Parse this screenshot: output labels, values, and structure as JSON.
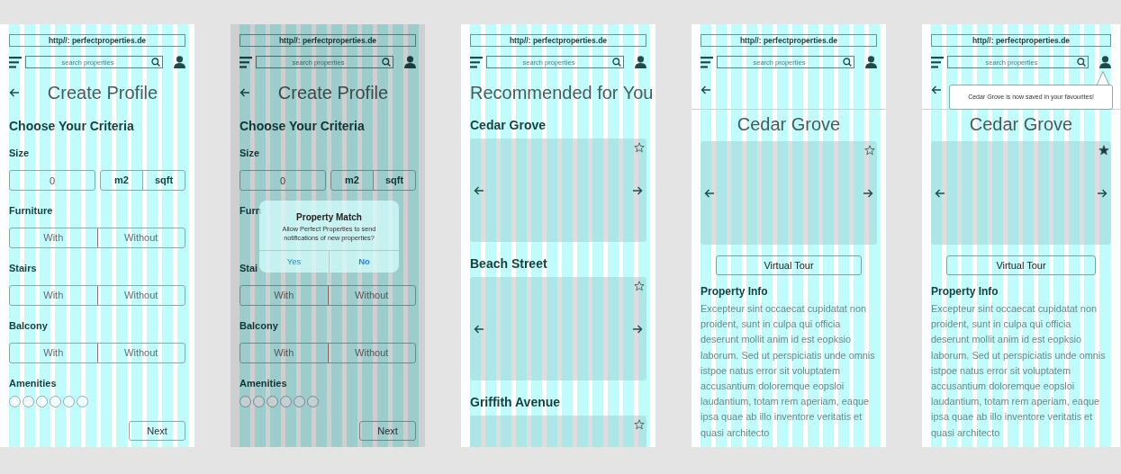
{
  "screens": [
    {
      "kind": "profile",
      "url": "http//: perfectproperties.de",
      "search": {
        "placeholder": "search properties"
      },
      "title": "Create Profile",
      "heading": "Choose Your Criteria",
      "size": {
        "label": "Size",
        "value": "0",
        "units": [
          "m2",
          "sqft"
        ]
      },
      "criteria": [
        {
          "label": "Furniture",
          "options": [
            "With",
            "Without"
          ]
        },
        {
          "label": "Stairs",
          "options": [
            "With",
            "Without"
          ]
        },
        {
          "label": "Balcony",
          "options": [
            "With",
            "Without"
          ]
        }
      ],
      "amenities": {
        "label": "Amenities",
        "options": [
          {
            "checked": false
          },
          {
            "checked": false
          },
          {
            "checked": false
          },
          {
            "checked": false
          },
          {
            "checked": false
          },
          {
            "checked": false
          }
        ]
      },
      "next": "Next"
    },
    {
      "kind": "profile",
      "dimmed": true,
      "url": "http//: perfectproperties.de",
      "search": {
        "placeholder": "search properties"
      },
      "title": "Create Profile",
      "heading": "Choose Your Criteria",
      "size": {
        "label": "Size",
        "value": "0",
        "units": [
          "m2",
          "sqft"
        ]
      },
      "criteria": [
        {
          "label": "Furn"
        },
        {
          "label": "Stai",
          "options": [
            "With",
            "Without"
          ]
        },
        {
          "label": "Balcony",
          "options": [
            "With",
            "Without"
          ]
        }
      ],
      "amenities": {
        "label": "Amenities",
        "options": [
          {
            "checked": false
          },
          {
            "checked": false
          },
          {
            "checked": false
          },
          {
            "checked": false
          },
          {
            "checked": false
          },
          {
            "checked": false
          }
        ]
      },
      "next": "Next",
      "dialog": {
        "title": "Property Match",
        "message": "Allow Perfect Properties to send notifications of new properties?",
        "buttons": [
          "Yes",
          "No"
        ]
      }
    },
    {
      "kind": "list",
      "url": "http//: perfectproperties.de",
      "search": {
        "placeholder": "search properties"
      },
      "title": "Recommended for You",
      "properties": [
        {
          "name": "Cedar Grove",
          "favourite": false
        },
        {
          "name": "Beach Street",
          "favourite": false
        },
        {
          "name": "Griffith Avenue",
          "favourite": false,
          "cut": true
        }
      ]
    },
    {
      "kind": "detail",
      "url": "http//: perfectproperties.de",
      "search": {
        "placeholder": "search properties"
      },
      "title": "Cedar Grove",
      "favourite": false,
      "button": "Virtual Tour",
      "info_heading": "Property Info",
      "info": "Excepteur sint occaecat cupidatat non proident, sunt in culpa qui officia deserunt mollit anim id est eopksio laborum. Sed ut perspiciatis unde omnis istpoe natus error sit voluptatem accusantium doloremque eopsloi laudantium, totam rem aperiam, eaque ipsa quae ab illo inventore veritatis et quasi architecto"
    },
    {
      "kind": "detail",
      "url": "http//: perfectproperties.de",
      "search": {
        "placeholder": "search properties"
      },
      "title": "Cedar Grove",
      "favourite": true,
      "button": "Virtual Tour",
      "info_heading": "Property Info",
      "info": "Excepteur sint occaecat cupidatat non proident, sunt in culpa qui officia deserunt mollit anim id est eopksio laborum. Sed ut perspiciatis unde omnis istpoe natus error sit voluptatem accusantium doloremque eopsloi laudantium, totam rem aperiam, eaque ipsa quae ab illo inventore veritatis et quasi architecto",
      "toast": "Cedar Grove is now saved in your favourites!"
    }
  ]
}
